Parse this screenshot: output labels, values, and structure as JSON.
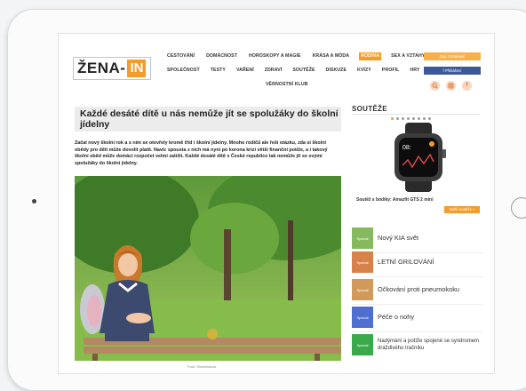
{
  "site": {
    "logo_word": "ŽENA-",
    "logo_highlight": "IN",
    "colors": {
      "accent": "#f39b2b",
      "facebook": "#3b5998",
      "notif": "#f8b04a"
    }
  },
  "nav": {
    "row1": [
      {
        "label": "CESTOVÁNÍ"
      },
      {
        "label": "DOMÁCNOST"
      },
      {
        "label": "HOROSKOPY A MAGIE"
      },
      {
        "label": "KRÁSA A MÓDA"
      },
      {
        "label": "RODINA",
        "active": true
      },
      {
        "label": "SEX A VZTAHY"
      }
    ],
    "row2": [
      {
        "label": "SPOLEČNOST"
      },
      {
        "label": "TESTY"
      },
      {
        "label": "VAŘENÍ"
      },
      {
        "label": "ZDRAVÍ"
      },
      {
        "label": "SOUTĚŽE"
      },
      {
        "label": "DISKUZE"
      },
      {
        "label": "KVÍZY"
      },
      {
        "label": "PROFIL"
      },
      {
        "label": "HRY"
      }
    ],
    "row3": [
      {
        "label": "VĚRNOSTNÍ KLUB"
      }
    ]
  },
  "header_buttons": {
    "notif_label": "Zap. Oznámení",
    "fb_label": "f Přihlášení"
  },
  "header_icons": [
    "search-icon",
    "instagram-icon",
    "facebook-icon"
  ],
  "article": {
    "title": "Každé desáté dítě u nás nemůže jít se spolužáky do školní jídelny",
    "lead": "Začal nový školní rok a s ním se otevřely kromě tříd i školní jídelny. Mnoho rodičů ale řeší otázku, zda si školní obědy pro děti může dovolit platit. Navíc spousta z nich má nyní po korona krizi větší finanční potíže, a i takový školní oběd může domácí rozpočet velmi zatížit. Každé desáté dítě v České republice tak nemůže jít se svými spolužáky do školní jídelny.",
    "photo_caption": "Foto: Shutterstock"
  },
  "sidebar": {
    "heading": "SOUTĚŽE",
    "contest_caption": "Soutěž s bodíky: Amazfit GTS 2 mini",
    "more_label": "Další soutěže »",
    "carousel": {
      "count": 8,
      "active_index": 0
    },
    "items": [
      {
        "badge": "Speciál",
        "text": "Nový KIA svět",
        "color": "#86b95d"
      },
      {
        "badge": "Speciál",
        "text": "LETNÍ GRILOVÁNÍ",
        "color": "#d7824a"
      },
      {
        "badge": "Speciál",
        "text": "Očkování proti pneumokoku",
        "color": "#d19a5c"
      },
      {
        "badge": "Speciál",
        "text": "Péče o nohy",
        "color": "#4f6fd0"
      },
      {
        "badge": "Speciál",
        "text": "Nadýmání a potíže spojené se syndromem dráždivého tračníku",
        "color": "#3aa94a"
      }
    ]
  }
}
